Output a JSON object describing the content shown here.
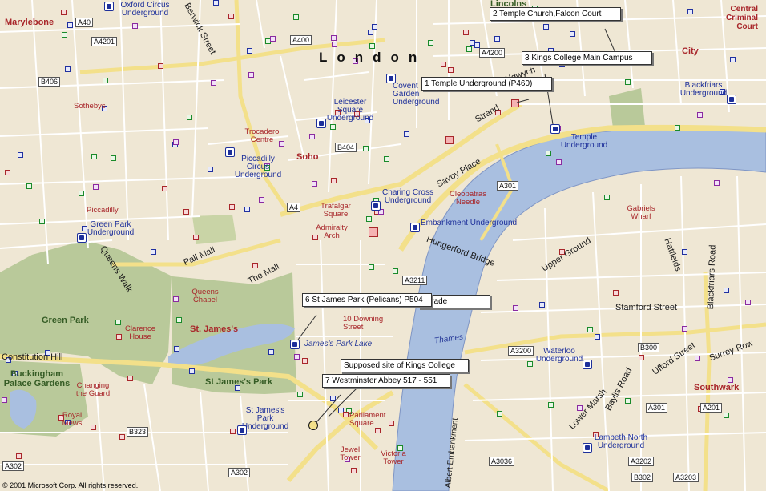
{
  "map": {
    "city_label": "London",
    "copyright": "© 2001 Microsoft Corp. All rights reserved.",
    "river": "Thames",
    "lake": "James's Park Lake",
    "areas": [
      "Marylebone",
      "Soho",
      "St. James's",
      "Southwark",
      "City",
      "Lincolns",
      "Central Criminal Court"
    ],
    "parks": [
      "Green Park",
      "Buckingham Palace Gardens",
      "St James's Park"
    ],
    "underground": [
      "Oxford Circus Underground",
      "Covent Garden Underground",
      "Leicester Square Underground",
      "Piccadilly Circus Underground",
      "Green Park Underground",
      "Charing Cross Underground",
      "Embankment Underground",
      "Temple Underground",
      "Blackfriars Underground",
      "Waterloo Underground",
      "Lambeth North Underground",
      "St James's Park Underground"
    ],
    "places": [
      "Sothebys",
      "Trocadero Centre",
      "Piccadilly",
      "Trafalgar Square",
      "Admiralty Arch",
      "Cleopatras Needle",
      "Gabriels Wharf",
      "Queens Chapel",
      "Clarence House",
      "Changing the Guard",
      "Royal Mews",
      "10 Downing Street",
      "Parliament Square",
      "Jewel Tower",
      "Victoria Tower"
    ],
    "streets": [
      "Berwick Street",
      "Strand",
      "Aldwych",
      "Savoy Place",
      "Hungerford Bridge",
      "Upper Ground",
      "Hatfields",
      "Blackfriars Road",
      "Stamford Street",
      "Baylis Road",
      "Lower Marsh",
      "Ufford Street",
      "Surrey Row",
      "Pall Mall",
      "The Mall",
      "Queens Walk",
      "Constitution Hill",
      "Albert Embankment",
      "Horse Guards Parade"
    ],
    "roads": [
      "A40",
      "A4201",
      "A400",
      "A4200",
      "B406",
      "B404",
      "A4",
      "A301",
      "A3211",
      "A3200",
      "B300",
      "A301",
      "A201",
      "A3036",
      "A3202",
      "A3203",
      "A302",
      "B323",
      "A302",
      "B302"
    ],
    "callouts": [
      "2 Temple Church,Falcon Court",
      "3 Kings College Main Campus",
      "1 Temple Underground (P460)",
      "6 St James Park (Pelicans) P504",
      "Supposed site of Kings College",
      "7 Westminster Abbey 517 - 551"
    ],
    "colors": {
      "land": "#efe7d4",
      "park": "#b9c99a",
      "water": "#a9bfe0",
      "major_road": "#f3e08a",
      "street": "#ffffff"
    }
  }
}
